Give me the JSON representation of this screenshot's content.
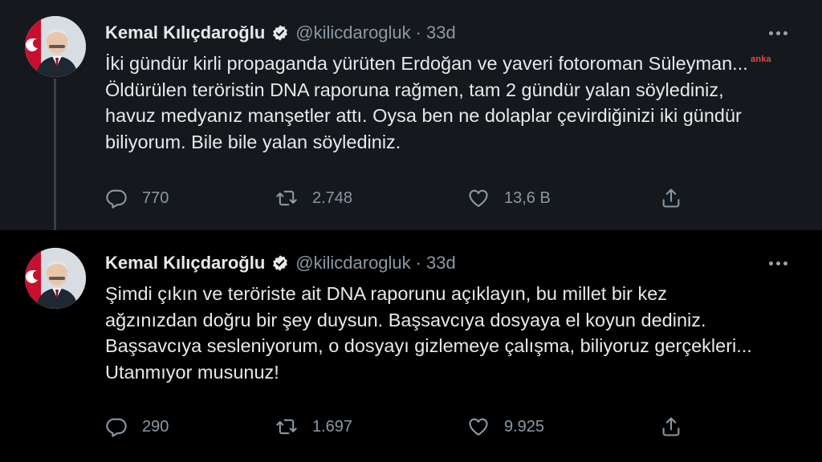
{
  "watermark": "anka",
  "tweets": [
    {
      "author_name": "Kemal Kılıçdaroğlu",
      "handle": "@kilicdarogluk",
      "separator": "·",
      "time": "33d",
      "text_lines": [
        "İki gündür kirli propaganda yürüten Erdoğan ve yaveri fotoroman Süleyman...",
        "Öldürülen teröristin DNA raporuna rağmen, tam 2 gündür yalan söylediniz,",
        "havuz medyanız manşetler attı. Oysa ben ne dolaplar çevirdiğinizi iki gündür",
        "biliyorum. Bile bile yalan söylediniz."
      ],
      "replies": "770",
      "retweets": "2.748",
      "likes": "13,6 B"
    },
    {
      "author_name": "Kemal Kılıçdaroğlu",
      "handle": "@kilicdarogluk",
      "separator": "·",
      "time": "33d",
      "text_lines": [
        "Şimdi çıkın ve teröriste ait DNA raporunu açıklayın, bu millet bir kez",
        "ağzınızdan doğru bir şey duysun. Başsavcıya dosyaya el koyun dediniz.",
        "Başsavcıya sesleniyorum, o dosyayı gizlemeye çalışma, biliyoruz gerçekleri...",
        "Utanmıyor musunuz!"
      ],
      "replies": "290",
      "retweets": "1.697",
      "likes": "9.925"
    }
  ],
  "colors": {
    "background_top": "#15181c",
    "background_bottom": "#000000",
    "text": "#e7e9ea",
    "muted": "#8b98a5",
    "verified_badge": "#e7e9ea",
    "watermark": "#e8483f"
  },
  "icons": [
    "avatar",
    "verified-badge-icon",
    "more-options-icon",
    "reply-icon",
    "retweet-icon",
    "like-icon",
    "share-icon"
  ]
}
